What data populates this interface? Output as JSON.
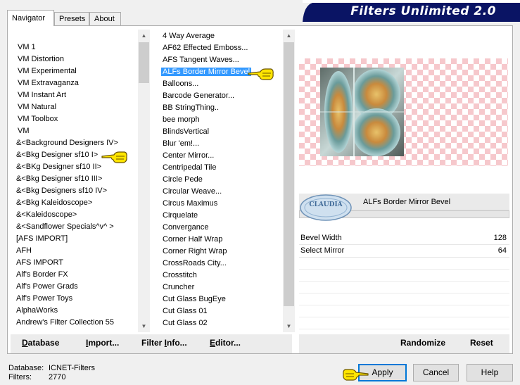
{
  "tabs": [
    {
      "label": "Navigator",
      "active": true
    },
    {
      "label": "Presets",
      "active": false
    },
    {
      "label": "About",
      "active": false
    }
  ],
  "banner": {
    "title": "Filters Unlimited 2.0",
    "color": "#0a1464"
  },
  "categories": [
    "VM 1",
    "VM Distortion",
    "VM Experimental",
    "VM Extravaganza",
    "VM Instant Art",
    "VM Natural",
    "VM Toolbox",
    "VM",
    "&<Background Designers IV>",
    "&<Bkg Designer sf10 I>",
    "&<BKg Designer sf10 II>",
    "&<Bkg Designer sf10 III>",
    "&<Bkg Designers sf10 IV>",
    "&<Bkg Kaleidoscope>",
    "&<Kaleidoscope>",
    "&<Sandflower Specials^v^ >",
    "[AFS IMPORT]",
    "AFH",
    "AFS IMPORT",
    "Alf's Border FX",
    "Alf's Power Grads",
    "Alf's Power Toys",
    "AlphaWorks",
    "Andrew's Filter Collection 55"
  ],
  "filters": [
    "4 Way Average",
    "AF62 Effected Emboss...",
    "AFS Tangent Waves...",
    "ALFs Border Mirror Bevel",
    "Balloons...",
    "Barcode Generator...",
    "BB StringThing..",
    "bee morph",
    "BlindsVertical",
    "Blur 'em!...",
    "Center Mirror...",
    "Centripedal Tile",
    "Circle Pede",
    "Circular Weave...",
    "Circus Maximus",
    "Cirquelate",
    "Convergance",
    "Corner Half Wrap",
    "Corner Right Wrap",
    "CrossRoads City...",
    "Crosstitch",
    "Cruncher",
    "Cut Glass  BugEye",
    "Cut Glass 01",
    "Cut Glass 02"
  ],
  "selected_filter": "ALFs Border Mirror Bevel",
  "selection_color": "#3399ff",
  "filter_name_display": "ALFs Border Mirror Bevel",
  "watermark": {
    "text": "CLAUDIA"
  },
  "parameters": [
    {
      "label": "Bevel Width",
      "value": "128"
    },
    {
      "label": "Select Mirror",
      "value": "64"
    }
  ],
  "left_buttons": {
    "database": {
      "u": "D",
      "rest": "atabase"
    },
    "import": {
      "u": "I",
      "rest": "mport..."
    },
    "filter_info": {
      "pre": "Filter ",
      "u": "I",
      "rest": "nfo..."
    },
    "editor": {
      "u": "E",
      "rest": "ditor..."
    }
  },
  "right_buttons": {
    "randomize": "Randomize",
    "reset": "Reset"
  },
  "db_info": {
    "database_label": "Database:",
    "database_value": "ICNET-Filters",
    "filters_label": "Filters:",
    "filters_value": "2770"
  },
  "dialog_buttons": {
    "apply": "Apply",
    "cancel": "Cancel",
    "help": "Help"
  },
  "pointer_hand_icons": [
    "pointer-hand-icon"
  ]
}
